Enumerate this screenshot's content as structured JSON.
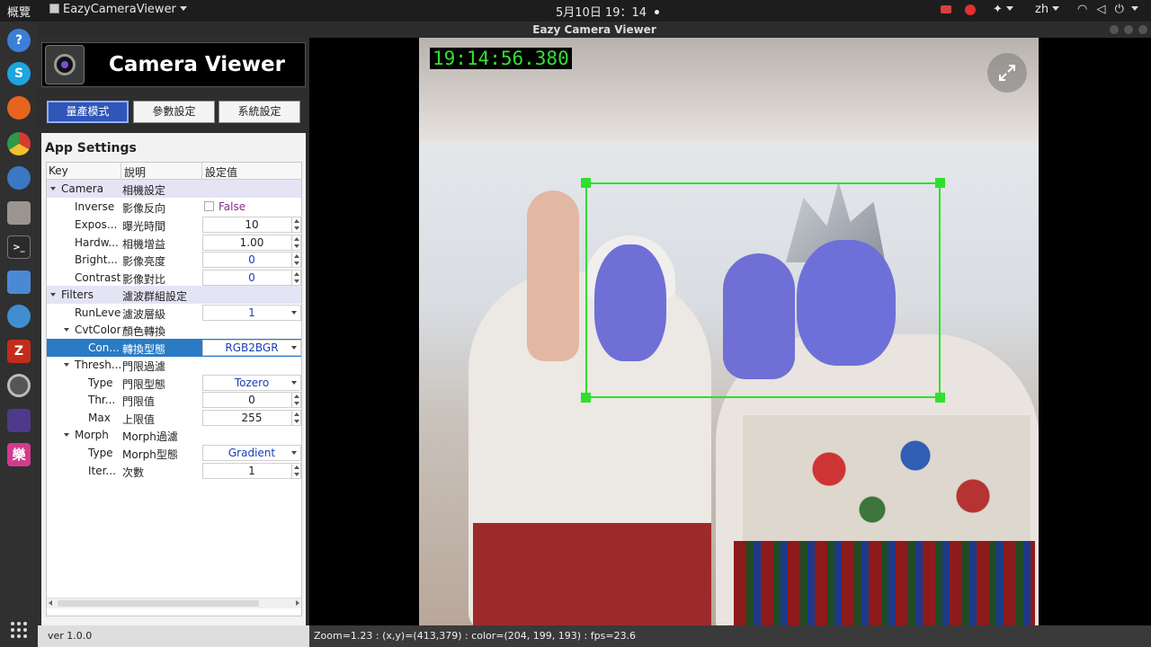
{
  "topbar": {
    "activities": "概覽",
    "app_name": "EazyCameraViewer",
    "clock": "5月10日 19：14",
    "lang": "zh"
  },
  "window": {
    "title": "Eazy Camera Viewer"
  },
  "app": {
    "title": "Camera Viewer",
    "modes": [
      {
        "label": "量產模式",
        "active": true
      },
      {
        "label": "參數設定",
        "active": false
      },
      {
        "label": "系統設定",
        "active": false
      }
    ]
  },
  "settings": {
    "title": "App Settings",
    "headers": {
      "key": "Key",
      "desc": "說明",
      "value": "設定值"
    },
    "rows": [
      {
        "key": "Camera",
        "desc": "相機設定",
        "type": "group"
      },
      {
        "key": "Inverse",
        "desc": "影像反向",
        "value": "False",
        "type": "bool"
      },
      {
        "key": "Expos...",
        "desc": "曝光時間",
        "value": "10",
        "type": "spin"
      },
      {
        "key": "Hardw...",
        "desc": "相機增益",
        "value": "1.00",
        "type": "spin"
      },
      {
        "key": "Bright...",
        "desc": "影像亮度",
        "value": "0",
        "type": "spin",
        "blue": true
      },
      {
        "key": "Contrast",
        "desc": "影像對比",
        "value": "0",
        "type": "spin",
        "blue": true
      },
      {
        "key": "Filters",
        "desc": "濾波群組設定",
        "type": "group"
      },
      {
        "key": "RunLevel",
        "desc": "濾波層級",
        "value": "1",
        "type": "combo",
        "blue": true
      },
      {
        "key": "CvtColor",
        "desc": "顏色轉換",
        "type": "subgroup"
      },
      {
        "key": "Con...",
        "desc": "轉換型態",
        "value": "RGB2BGR",
        "type": "combo",
        "blue": true,
        "selected": true
      },
      {
        "key": "Thresh...",
        "desc": "門限過濾",
        "type": "subgroup"
      },
      {
        "key": "Type",
        "desc": "門限型態",
        "value": "Tozero",
        "type": "combo",
        "blue": true
      },
      {
        "key": "Thr...",
        "desc": "門限值",
        "value": "0",
        "type": "spin"
      },
      {
        "key": "Max",
        "desc": "上限值",
        "value": "255",
        "type": "spin"
      },
      {
        "key": "Morph",
        "desc": "Morph過濾",
        "type": "subgroup"
      },
      {
        "key": "Type",
        "desc": "Morph型態",
        "value": "Gradient",
        "type": "combo",
        "blue": true
      },
      {
        "key": "Iter...",
        "desc": "次數",
        "value": "1",
        "type": "spin"
      }
    ]
  },
  "viewer": {
    "timestamp": "19:14:56.380",
    "roi_color": "#2ee02e"
  },
  "status": {
    "version": "ver 1.0.0",
    "text": "Zoom=1.23 : (x,y)=(413,379) : color=(204, 199, 193) : fps=23.6"
  }
}
